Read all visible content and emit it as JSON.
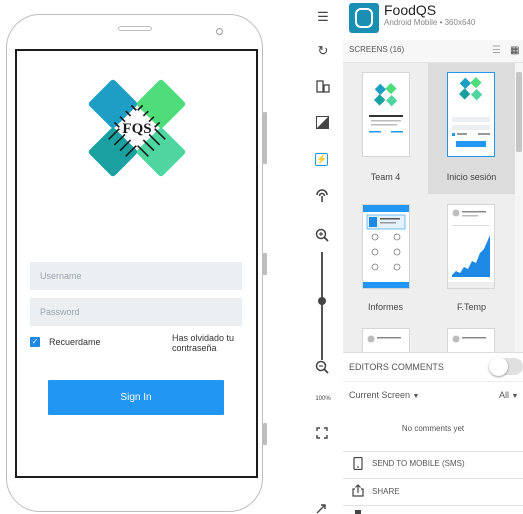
{
  "phone": {
    "username_placeholder": "Username",
    "password_placeholder": "Password",
    "remember_label": "Recuerdame",
    "forgot_label": "Has olvidado tu contraseña",
    "sign_in_label": "Sign In",
    "logo_text": "FQS",
    "remember_checked": true
  },
  "toolbar": {
    "menu_icon": "☰",
    "refresh_icon": "C",
    "zoom_percent": "100%",
    "zoom_level": 0.45
  },
  "app": {
    "title": "FoodQS",
    "subtitle": "Android Mobile • 360x640"
  },
  "screens": {
    "title": "SCREENS (16)",
    "items": [
      {
        "label": "Team 4"
      },
      {
        "label": "Inicio sesión"
      },
      {
        "label": "Informes"
      },
      {
        "label": "F.Temp"
      }
    ]
  },
  "comments": {
    "title": "EDITORS COMMENTS",
    "current_screen": "Current Screen",
    "filter": "All",
    "empty": "No comments yet"
  },
  "actions": {
    "send_mobile": "SEND TO MOBILE (SMS)",
    "share": "SHARE"
  },
  "colors": {
    "primary": "#2196f3",
    "logo_green": "#4fdc7b",
    "logo_teal": "#1aa0a0",
    "logo_blue": "#1e9ec4",
    "app_icon": "#1a8fb3"
  }
}
